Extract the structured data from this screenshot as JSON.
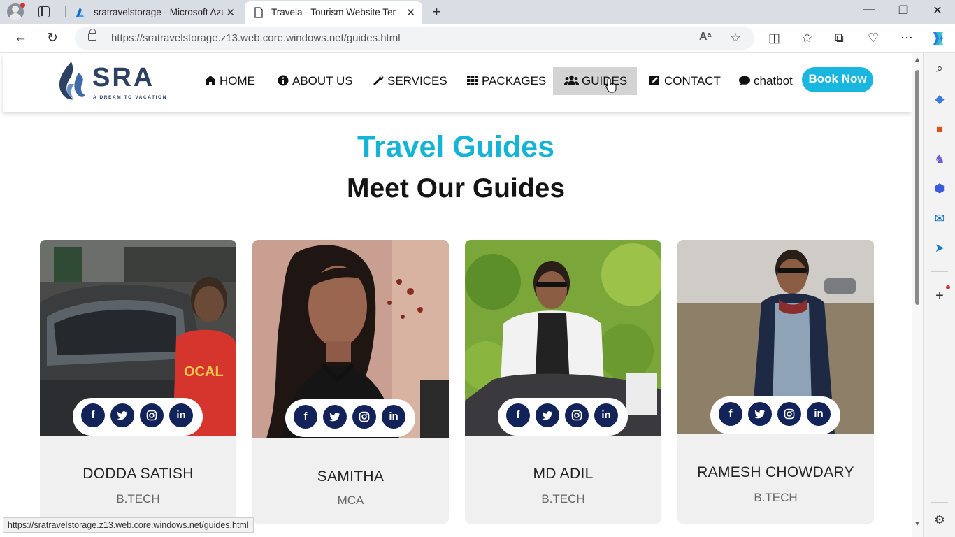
{
  "browser": {
    "tabs": [
      {
        "title": "sratravelstorage - Microsoft Azur",
        "favicon": "azure-icon"
      },
      {
        "title": "Travela - Tourism Website Templ",
        "favicon": "page-icon"
      }
    ],
    "url": "https://sratravelstorage.z13.web.core.windows.net/guides.html",
    "status_url": "https://sratravelstorage.z13.web.core.windows.net/guides.html"
  },
  "site": {
    "logo": {
      "text": "SRA",
      "tagline": "A DREAM TO VACATION"
    },
    "menu": [
      {
        "label": "HOME",
        "icon": "home-icon"
      },
      {
        "label": "ABOUT US",
        "icon": "info-circle-icon"
      },
      {
        "label": "SERVICES",
        "icon": "wrench-icon"
      },
      {
        "label": "PACKAGES",
        "icon": "grid-icon"
      },
      {
        "label": "GUIDES",
        "icon": "users-icon",
        "active": true
      },
      {
        "label": "CONTACT",
        "icon": "edit-square-icon"
      },
      {
        "label": "chatbot",
        "icon": "chat-bubble-icon"
      }
    ],
    "book_now": "Book Now"
  },
  "section": {
    "subtitle": "Travel Guides",
    "title": "Meet Our Guides"
  },
  "social": {
    "facebook": "f",
    "twitter": "twitter-bird-icon",
    "instagram": "instagram-icon",
    "linkedin": "in"
  },
  "guides": [
    {
      "name": "DODDA SATISH",
      "degree": "B.TECH"
    },
    {
      "name": "SAMITHA",
      "degree": "MCA"
    },
    {
      "name": "MD ADIL",
      "degree": "B.TECH"
    },
    {
      "name": "RAMESH CHOWDARY",
      "degree": "B.TECH"
    }
  ],
  "colors": {
    "accent": "#19b7e0",
    "brand_navy": "#2d4263",
    "social_button": "#12235a",
    "active_menu_bg": "#d3d3d3"
  }
}
